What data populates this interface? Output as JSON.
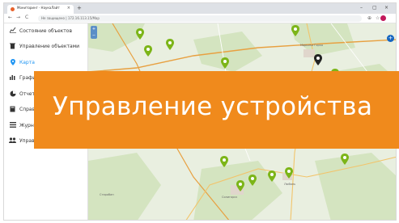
{
  "browser": {
    "tab_title": "Мониторинг · НаукаЛайт",
    "tab_close": "×",
    "new_tab": "+",
    "win_controls": [
      "–",
      "▢",
      "×"
    ],
    "nav": [
      "←",
      "→",
      "C"
    ],
    "address": "Не защищено  |  172.16.113.15/Map",
    "toolbar_icons": [
      "⊕",
      "☆"
    ]
  },
  "sidebar": {
    "items": [
      {
        "icon": "chart-line-icon",
        "glyph": "📈",
        "label": "Состояние объектов",
        "active": false
      },
      {
        "icon": "trash-bin-icon",
        "glyph": "🗑",
        "label": "Управление объектами",
        "active": false
      },
      {
        "icon": "map-pin-icon",
        "glyph": "📍",
        "label": "Карта",
        "active": true
      },
      {
        "icon": "bar-chart-icon",
        "glyph": "📊",
        "label": "Графики",
        "active": false
      },
      {
        "icon": "pie-chart-icon",
        "glyph": "◕",
        "label": "Отчеты",
        "active": false
      },
      {
        "icon": "book-icon",
        "glyph": "📘",
        "label": "Справочники",
        "active": false
      },
      {
        "icon": "list-icon",
        "glyph": "☰",
        "label": "Журнал",
        "active": false
      },
      {
        "icon": "users-icon",
        "glyph": "👥",
        "label": "Управление",
        "active": false
      }
    ]
  },
  "map": {
    "zoom_controls": [
      "+",
      "−"
    ],
    "locate": "+",
    "place_labels": [
      "Марьина Горка",
      "Пуховичи",
      "Любань",
      "Старобин",
      "Солигорск"
    ],
    "marker_colors": {
      "online": "#7cb518",
      "selected": "#222222"
    }
  },
  "banner": {
    "text": "Управление устройства",
    "color": "#f08a1c"
  }
}
